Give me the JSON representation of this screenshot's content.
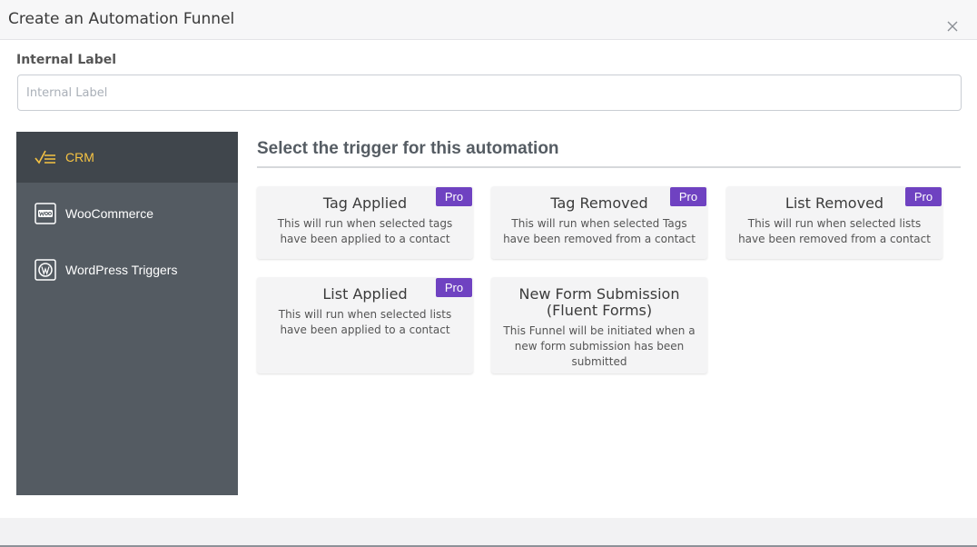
{
  "modal": {
    "title": "Create an Automation Funnel",
    "close_icon": "close-icon"
  },
  "form": {
    "label": "Internal Label",
    "placeholder": "Internal Label",
    "value": ""
  },
  "sidebar": {
    "items": [
      {
        "label": "CRM",
        "icon": "crm-checklist-icon",
        "active": true
      },
      {
        "label": "WooCommerce",
        "icon": "woocommerce-icon",
        "active": false
      },
      {
        "label": "WordPress Triggers",
        "icon": "wordpress-icon",
        "active": false
      }
    ]
  },
  "main": {
    "heading": "Select the trigger for this automation",
    "cards": [
      {
        "title": "Tag Applied",
        "description": "This will run when selected tags have been applied to a contact",
        "badge": "Pro"
      },
      {
        "title": "Tag Removed",
        "description": "This will run when selected Tags have been removed from a contact",
        "badge": "Pro"
      },
      {
        "title": "List Removed",
        "description": "This will run when selected lists have been removed from a contact",
        "badge": "Pro"
      },
      {
        "title": "List Applied",
        "description": "This will run when selected lists have been applied to a contact",
        "badge": "Pro"
      },
      {
        "title": "New Form Submission (Fluent Forms)",
        "description": "This Funnel will be initiated when a new form submission has been submitted",
        "badge": ""
      }
    ]
  },
  "colors": {
    "sidebar_bg": "#545b62",
    "sidebar_active_bg": "#40464c",
    "active_text": "#f6c343",
    "pro_badge": "#6f42c1",
    "card_bg": "#f4f4f5"
  }
}
